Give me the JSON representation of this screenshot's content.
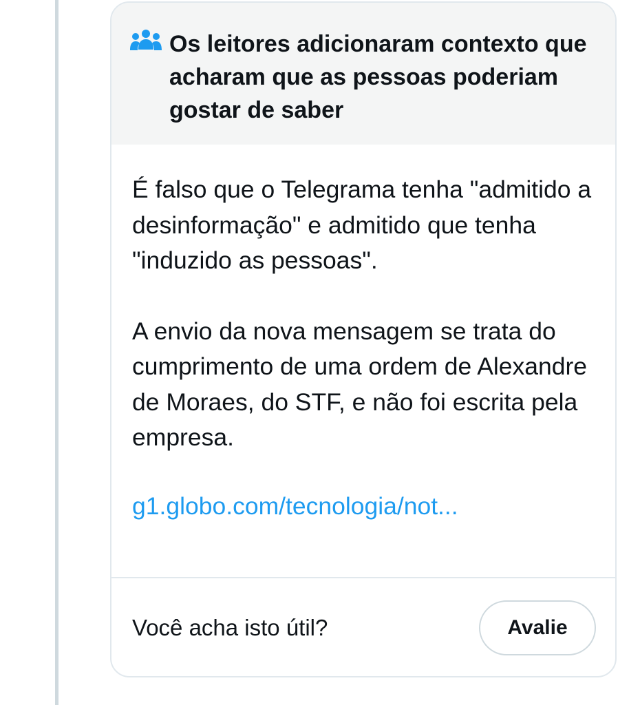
{
  "note": {
    "title": "Os leitores adicionaram contexto que acharam que as pessoas poderiam gostar de saber",
    "title_icon": "people-icon",
    "paragraph_1": "É falso que o Telegrama tenha \"admitido a desinformação\" e admitido que tenha \"induzido as pessoas\".",
    "paragraph_2": "A envio da nova mensagem se trata do cumprimento de uma ordem de Alexandre de Moraes, do STF, e não foi escrita pela empresa.",
    "link_text": "g1.globo.com/tecnologia/not...",
    "helpful_question": "Você acha isto útil?",
    "rate_button_label": "Avalie"
  },
  "colors": {
    "accent": "#1d9bf0",
    "text": "#0f1419",
    "header_bg": "#f4f5f5",
    "border": "#e1e8ed"
  }
}
